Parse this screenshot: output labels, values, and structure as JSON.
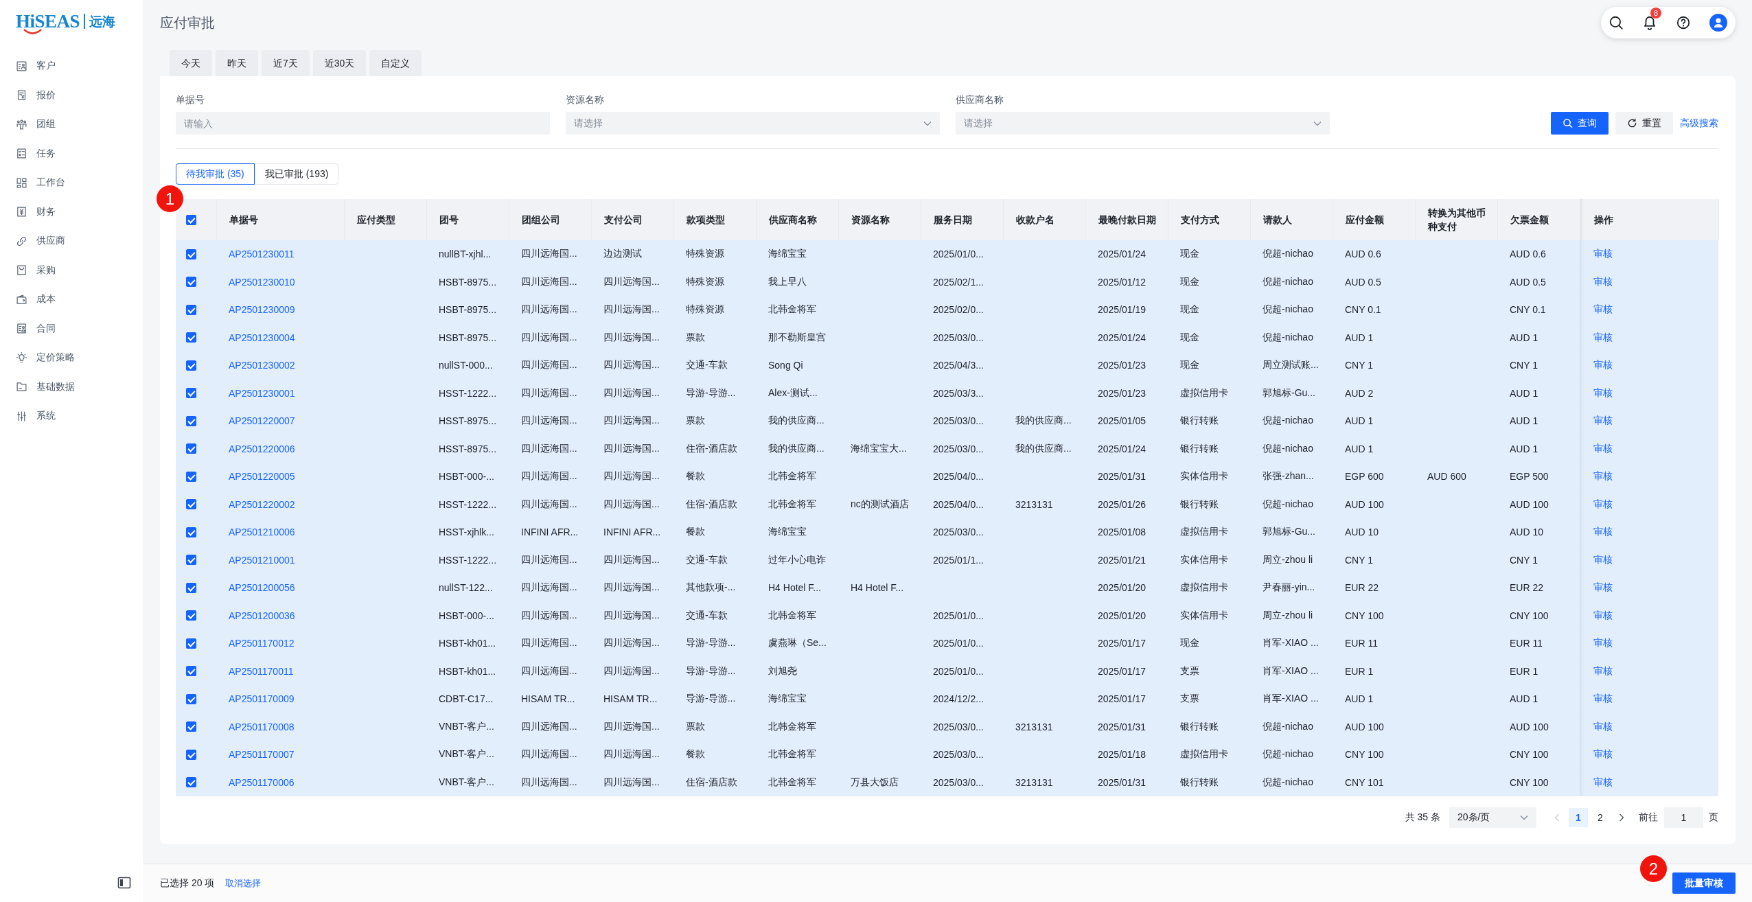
{
  "sidebar": {
    "logo": {
      "brand": "HiSEAS",
      "chinese_name": "远海"
    },
    "items": [
      {
        "label": "客户",
        "selected": false
      },
      {
        "label": "报价",
        "selected": false
      },
      {
        "label": "团组",
        "selected": false
      },
      {
        "label": "任务",
        "selected": false
      },
      {
        "label": "工作台",
        "selected": false
      },
      {
        "label": "财务",
        "selected": false
      },
      {
        "label": "供应商",
        "selected": false
      },
      {
        "label": "采购",
        "selected": false
      },
      {
        "label": "成本",
        "selected": false
      },
      {
        "label": "合同",
        "selected": false
      },
      {
        "label": "定价策略",
        "selected": false
      },
      {
        "label": "基础数据",
        "selected": false
      },
      {
        "label": "系统",
        "selected": false
      }
    ]
  },
  "header": {
    "title": "应付审批",
    "notification_badge": "8"
  },
  "date_tabs": [
    {
      "label": "今天",
      "selected": false
    },
    {
      "label": "昨天",
      "selected": false
    },
    {
      "label": "近7天",
      "selected": false
    },
    {
      "label": "近30天",
      "selected": false
    },
    {
      "label": "自定义",
      "selected": false
    }
  ],
  "filters": {
    "fields": [
      {
        "label": "单据号",
        "kind": "input",
        "placeholder": "请输入"
      },
      {
        "label": "资源名称",
        "kind": "select",
        "placeholder": "请选择"
      },
      {
        "label": "供应商名称",
        "kind": "select",
        "placeholder": "请选择"
      }
    ],
    "buttons": [
      {
        "label": "查询",
        "kind": "primary"
      },
      {
        "label": "重置",
        "kind": "secondary"
      },
      {
        "label": "高级搜索",
        "kind": "link"
      }
    ]
  },
  "status_tabs": [
    {
      "label": "待我审批 (35)",
      "selected": true
    },
    {
      "label": "我已审批 (193)",
      "selected": false
    }
  ],
  "table": {
    "all_selected": true,
    "columns": [
      {
        "label": "单据号",
        "kind": "link"
      },
      {
        "label": "应付类型",
        "kind": "text"
      },
      {
        "label": "团号",
        "kind": "text"
      },
      {
        "label": "团组公司",
        "kind": "text"
      },
      {
        "label": "支付公司",
        "kind": "text"
      },
      {
        "label": "款项类型",
        "kind": "text"
      },
      {
        "label": "供应商名称",
        "kind": "text"
      },
      {
        "label": "资源名称",
        "kind": "text"
      },
      {
        "label": "服务日期",
        "kind": "text"
      },
      {
        "label": "收款户名",
        "kind": "text"
      },
      {
        "label": "最晚付款日期",
        "kind": "text"
      },
      {
        "label": "支付方式",
        "kind": "text"
      },
      {
        "label": "请款人",
        "kind": "text"
      },
      {
        "label": "应付金额",
        "kind": "text"
      },
      {
        "label": "转换为其他币种支付",
        "kind": "text"
      },
      {
        "label": "欠票金额",
        "kind": "text"
      },
      {
        "label": "操作",
        "kind": "link"
      }
    ],
    "rows": [
      {
        "selected": true,
        "doc_no": "AP2501230011",
        "tour_no": "nullBT-xjhl...",
        "group_company": "四川远海国...",
        "paying_company": "边边测试",
        "payment_category": "特殊资源",
        "supplier": "海绵宝宝",
        "service_date": "2025/01/0...",
        "latest_payment_date": "2025/01/24",
        "payment_method": "现金",
        "requester": "倪超-nichao",
        "amount_payable": "AUD 0.6",
        "uninvoiced_amount": "AUD 0.6",
        "action": "审核"
      },
      {
        "selected": true,
        "doc_no": "AP2501230010",
        "tour_no": "HSBT-8975...",
        "group_company": "四川远海国...",
        "paying_company": "四川远海国...",
        "payment_category": "特殊资源",
        "supplier": "我上早八",
        "service_date": "2025/02/1...",
        "latest_payment_date": "2025/01/12",
        "payment_method": "现金",
        "requester": "倪超-nichao",
        "amount_payable": "AUD 0.5",
        "uninvoiced_amount": "AUD 0.5",
        "action": "审核"
      },
      {
        "selected": true,
        "doc_no": "AP2501230009",
        "tour_no": "HSBT-8975...",
        "group_company": "四川远海国...",
        "paying_company": "四川远海国...",
        "payment_category": "特殊资源",
        "supplier": "北韩金将军",
        "service_date": "2025/02/0...",
        "latest_payment_date": "2025/01/19",
        "payment_method": "现金",
        "requester": "倪超-nichao",
        "amount_payable": "CNY 0.1",
        "uninvoiced_amount": "CNY 0.1",
        "action": "审核"
      },
      {
        "selected": true,
        "doc_no": "AP2501230004",
        "tour_no": "HSBT-8975...",
        "group_company": "四川远海国...",
        "paying_company": "四川远海国...",
        "payment_category": "票款",
        "supplier": "那不勒斯皇宫",
        "service_date": "2025/03/0...",
        "latest_payment_date": "2025/01/24",
        "payment_method": "现金",
        "requester": "倪超-nichao",
        "amount_payable": "AUD 1",
        "uninvoiced_amount": "AUD 1",
        "action": "审核"
      },
      {
        "selected": true,
        "doc_no": "AP2501230002",
        "tour_no": "nullST-000...",
        "group_company": "四川远海国...",
        "paying_company": "四川远海国...",
        "payment_category": "交通-车款",
        "supplier": "Song Qi",
        "service_date": "2025/04/3...",
        "latest_payment_date": "2025/01/23",
        "payment_method": "现金",
        "requester": "周立测试账...",
        "amount_payable": "CNY 1",
        "uninvoiced_amount": "CNY 1",
        "action": "审核"
      },
      {
        "selected": true,
        "doc_no": "AP2501230001",
        "tour_no": "HSST-1222...",
        "group_company": "四川远海国...",
        "paying_company": "四川远海国...",
        "payment_category": "导游-导游...",
        "supplier": "Alex-测试...",
        "service_date": "2025/03/3...",
        "latest_payment_date": "2025/01/23",
        "payment_method": "虚拟信用卡",
        "requester": "郭旭标-Gu...",
        "amount_payable": "AUD 2",
        "uninvoiced_amount": "AUD 1",
        "action": "审核"
      },
      {
        "selected": true,
        "doc_no": "AP2501220007",
        "tour_no": "HSST-8975...",
        "group_company": "四川远海国...",
        "paying_company": "四川远海国...",
        "payment_category": "票款",
        "supplier": "我的供应商...",
        "service_date": "2025/03/0...",
        "payee_name": "我的供应商...",
        "latest_payment_date": "2025/01/05",
        "payment_method": "银行转账",
        "requester": "倪超-nichao",
        "amount_payable": "AUD 1",
        "uninvoiced_amount": "AUD 1",
        "action": "审核"
      },
      {
        "selected": true,
        "doc_no": "AP2501220006",
        "tour_no": "HSST-8975...",
        "group_company": "四川远海国...",
        "paying_company": "四川远海国...",
        "payment_category": "住宿-酒店款",
        "supplier": "我的供应商...",
        "resource": "海绵宝宝大...",
        "service_date": "2025/03/0...",
        "payee_name": "我的供应商...",
        "latest_payment_date": "2025/01/24",
        "payment_method": "银行转账",
        "requester": "倪超-nichao",
        "amount_payable": "AUD 1",
        "uninvoiced_amount": "AUD 1",
        "action": "审核"
      },
      {
        "selected": true,
        "doc_no": "AP2501220005",
        "tour_no": "HSBT-000-...",
        "group_company": "四川远海国...",
        "paying_company": "四川远海国...",
        "payment_category": "餐款",
        "supplier": "北韩金将军",
        "service_date": "2025/04/0...",
        "latest_payment_date": "2025/01/31",
        "payment_method": "实体信用卡",
        "requester": "张强-zhan...",
        "amount_payable": "EGP 600",
        "converted_payment": "AUD 600",
        "uninvoiced_amount": "EGP 500",
        "action": "审核"
      },
      {
        "selected": true,
        "doc_no": "AP2501220002",
        "tour_no": "HSST-1222...",
        "group_company": "四川远海国...",
        "paying_company": "四川远海国...",
        "payment_category": "住宿-酒店款",
        "supplier": "北韩金将军",
        "resource": "nc的测试酒店",
        "service_date": "2025/04/0...",
        "payee_name": "3213131",
        "latest_payment_date": "2025/01/26",
        "payment_method": "银行转账",
        "requester": "倪超-nichao",
        "amount_payable": "AUD 100",
        "uninvoiced_amount": "AUD 100",
        "action": "审核"
      },
      {
        "selected": true,
        "doc_no": "AP2501210006",
        "tour_no": "HSST-xjhlk...",
        "group_company": "INFINI AFR...",
        "paying_company": "INFINI AFR...",
        "payment_category": "餐款",
        "supplier": "海绵宝宝",
        "service_date": "2025/03/0...",
        "latest_payment_date": "2025/01/08",
        "payment_method": "虚拟信用卡",
        "requester": "郭旭标-Gu...",
        "amount_payable": "AUD 10",
        "uninvoiced_amount": "AUD 10",
        "action": "审核"
      },
      {
        "selected": true,
        "doc_no": "AP2501210001",
        "tour_no": "HSST-1222...",
        "group_company": "四川远海国...",
        "paying_company": "四川远海国...",
        "payment_category": "交通-车款",
        "supplier": "过年小心电诈",
        "service_date": "2025/01/1...",
        "latest_payment_date": "2025/01/21",
        "payment_method": "实体信用卡",
        "requester": "周立-zhou li",
        "amount_payable": "CNY 1",
        "uninvoiced_amount": "CNY 1",
        "action": "审核"
      },
      {
        "selected": true,
        "doc_no": "AP2501200056",
        "tour_no": "nullST-122...",
        "group_company": "四川远海国...",
        "paying_company": "四川远海国...",
        "payment_category": "其他款项-...",
        "supplier": "H4 Hotel F...",
        "resource": "H4 Hotel F...",
        "latest_payment_date": "2025/01/20",
        "payment_method": "虚拟信用卡",
        "requester": "尹春丽-yin...",
        "amount_payable": "EUR 22",
        "uninvoiced_amount": "EUR 22",
        "action": "审核"
      },
      {
        "selected": true,
        "doc_no": "AP2501200036",
        "tour_no": "HSBT-000-...",
        "group_company": "四川远海国...",
        "paying_company": "四川远海国...",
        "payment_category": "交通-车款",
        "supplier": "北韩金将军",
        "service_date": "2025/01/0...",
        "latest_payment_date": "2025/01/20",
        "payment_method": "实体信用卡",
        "requester": "周立-zhou li",
        "amount_payable": "CNY 100",
        "uninvoiced_amount": "CNY 100",
        "action": "审核"
      },
      {
        "selected": true,
        "doc_no": "AP2501170012",
        "tour_no": "HSBT-kh01...",
        "group_company": "四川远海国...",
        "paying_company": "四川远海国...",
        "payment_category": "导游-导游...",
        "supplier": "虞燕琳（Se...",
        "service_date": "2025/01/0...",
        "latest_payment_date": "2025/01/17",
        "payment_method": "现金",
        "requester": "肖军-XIAO ...",
        "amount_payable": "EUR 11",
        "uninvoiced_amount": "EUR 11",
        "action": "审核"
      },
      {
        "selected": true,
        "doc_no": "AP2501170011",
        "tour_no": "HSBT-kh01...",
        "group_company": "四川远海国...",
        "paying_company": "四川远海国...",
        "payment_category": "导游-导游...",
        "supplier": "刘旭尧",
        "service_date": "2025/01/0...",
        "latest_payment_date": "2025/01/17",
        "payment_method": "支票",
        "requester": "肖军-XIAO ...",
        "amount_payable": "EUR 1",
        "uninvoiced_amount": "EUR 1",
        "action": "审核"
      },
      {
        "selected": true,
        "doc_no": "AP2501170009",
        "tour_no": "CDBT-C17...",
        "group_company": "HISAM TR...",
        "paying_company": "HISAM TR...",
        "payment_category": "导游-导游...",
        "supplier": "海绵宝宝",
        "service_date": "2024/12/2...",
        "latest_payment_date": "2025/01/17",
        "payment_method": "支票",
        "requester": "肖军-XIAO ...",
        "amount_payable": "AUD 1",
        "uninvoiced_amount": "AUD 1",
        "action": "审核"
      },
      {
        "selected": true,
        "doc_no": "AP2501170008",
        "tour_no": "VNBT-客户...",
        "group_company": "四川远海国...",
        "paying_company": "四川远海国...",
        "payment_category": "票款",
        "supplier": "北韩金将军",
        "service_date": "2025/03/0...",
        "payee_name": "3213131",
        "latest_payment_date": "2025/01/31",
        "payment_method": "银行转账",
        "requester": "倪超-nichao",
        "amount_payable": "AUD 100",
        "uninvoiced_amount": "AUD 100",
        "action": "审核"
      },
      {
        "selected": true,
        "doc_no": "AP2501170007",
        "tour_no": "VNBT-客户...",
        "group_company": "四川远海国...",
        "paying_company": "四川远海国...",
        "payment_category": "餐款",
        "supplier": "北韩金将军",
        "service_date": "2025/03/0...",
        "latest_payment_date": "2025/01/18",
        "payment_method": "虚拟信用卡",
        "requester": "倪超-nichao",
        "amount_payable": "CNY 100",
        "uninvoiced_amount": "CNY 100",
        "action": "审核"
      },
      {
        "selected": true,
        "doc_no": "AP2501170006",
        "tour_no": "VNBT-客户...",
        "group_company": "四川远海国...",
        "paying_company": "四川远海国...",
        "payment_category": "住宿-酒店款",
        "supplier": "北韩金将军",
        "resource": "万县大饭店",
        "service_date": "2025/03/0...",
        "payee_name": "3213131",
        "latest_payment_date": "2025/01/31",
        "payment_method": "银行转账",
        "requester": "倪超-nichao",
        "amount_payable": "CNY 101",
        "uninvoiced_amount": "CNY 100",
        "action": "审核"
      }
    ]
  },
  "pagination": {
    "total": "共 35 条",
    "page_size": "20条/页",
    "prev_disabled": true,
    "pages": [
      {
        "label": "1",
        "selected": true
      },
      {
        "label": "2",
        "selected": false
      }
    ],
    "next_disabled": false,
    "goto_label": "前往",
    "goto_value": "1",
    "goto_suffix": "页"
  },
  "bottom_bar": {
    "selection_text": "已选择 20 项",
    "clear_link": "取消选择",
    "batch_button": "批量审核"
  },
  "annotation_markers": [
    {
      "label": "1"
    },
    {
      "label": "2"
    }
  ]
}
